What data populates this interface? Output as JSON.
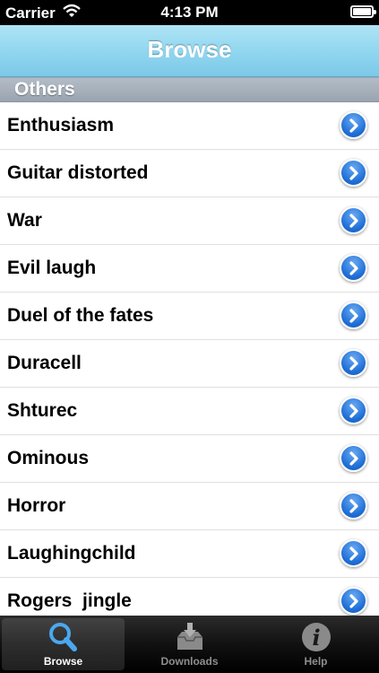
{
  "status_bar": {
    "carrier": "Carrier",
    "time": "4:13 PM"
  },
  "nav": {
    "title": "Browse"
  },
  "section": {
    "title": "Others"
  },
  "items": [
    "Enthusiasm",
    "Guitar distorted",
    "War",
    "Evil laugh",
    "Duel of the fates",
    "Duracell",
    "Shturec",
    "Ominous",
    "Horror",
    "Laughingchild",
    "Rogers  jingle"
  ],
  "tabs": [
    {
      "label": "Browse",
      "icon": "search-icon",
      "selected": true
    },
    {
      "label": "Downloads",
      "icon": "download-tray-icon",
      "selected": false
    },
    {
      "label": "Help",
      "icon": "info-icon",
      "selected": false
    }
  ],
  "colors": {
    "nav_bar": "#8dd4ee",
    "disclosure": "#1f6fd6",
    "tab_bar": "#111111"
  }
}
